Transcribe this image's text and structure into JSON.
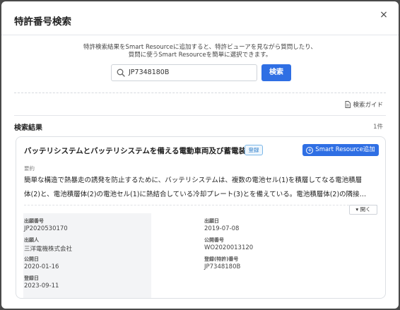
{
  "modal": {
    "title": "特許番号検索",
    "close_label": "×"
  },
  "description": {
    "line1": "特許検索結果をSmart Resourceに追加すると、特許ビューアを見ながら質問したり、",
    "line2": "質問に使うSmart Resourceを簡単に選択できます。"
  },
  "search": {
    "value": "JP7348180B",
    "button_label": "検索"
  },
  "guide": {
    "label": "検索ガイド"
  },
  "results": {
    "title": "検索結果",
    "count": "1件"
  },
  "result_card": {
    "title": "バッテリシステムとバッテリシステムを備える電動車両及び蓄電装置",
    "badge": "登録",
    "add_button": "Smart Resource追加",
    "abstract_label": "要約",
    "abstract_line1": "簡単な構造で熱暴走の誘発を防止するために、バッテリシステムは、複数の電池セル(1)を積層してなる電池積層",
    "abstract_line2": "体(2)と、電池積層体(2)の電池セル(1)に熱結合している冷却プレート(3)とを備えている。電池積層体(2)の隣接…",
    "expand_label": "開く",
    "fields": {
      "application_number_label": "出願番号",
      "application_number": "JP2020530170",
      "application_date_label": "出願日",
      "application_date": "2019-07-08",
      "applicant_label": "出願人",
      "applicant": "三洋電機株式会社",
      "publication_number_label": "公開番号",
      "publication_number": "WO2020013120",
      "publication_date_label": "公開日",
      "publication_date": "2020-01-16",
      "registration_number_label": "登録(特許)番号",
      "registration_number": "JP7348180B",
      "registration_date_label": "登録日",
      "registration_date": "2023-09-11"
    }
  },
  "colors": {
    "primary": "#2f6fe4",
    "badge_border": "#7bb7e8"
  }
}
